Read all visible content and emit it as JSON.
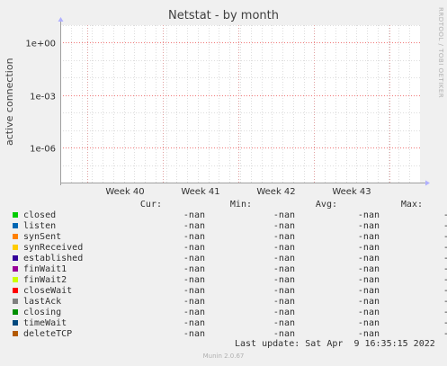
{
  "watermark": "RRDTOOL / TOBI OETIKER",
  "footer": "Munin 2.0.67",
  "last_update": "Last update: Sat Apr  9 16:35:15 2022",
  "columns": [
    "Cur:",
    "Min:",
    "Avg:",
    "Max:"
  ],
  "colors": {
    "background": "#f0f0f0",
    "plot_bg": "#ffffff",
    "grid_minor": "#dddddd",
    "grid_major": "#f07878",
    "vline_major": "#e0a0a0"
  },
  "legend": [
    {
      "name": "closed",
      "color": "#00cc00",
      "cur": "-nan",
      "min": "-nan",
      "avg": "-nan",
      "max": "-nan"
    },
    {
      "name": "listen",
      "color": "#0066b3",
      "cur": "-nan",
      "min": "-nan",
      "avg": "-nan",
      "max": "-nan"
    },
    {
      "name": "synSent",
      "color": "#ff8000",
      "cur": "-nan",
      "min": "-nan",
      "avg": "-nan",
      "max": "-nan"
    },
    {
      "name": "synReceived",
      "color": "#ffcc00",
      "cur": "-nan",
      "min": "-nan",
      "avg": "-nan",
      "max": "-nan"
    },
    {
      "name": "established",
      "color": "#330099",
      "cur": "-nan",
      "min": "-nan",
      "avg": "-nan",
      "max": "-nan"
    },
    {
      "name": "finWait1",
      "color": "#990099",
      "cur": "-nan",
      "min": "-nan",
      "avg": "-nan",
      "max": "-nan"
    },
    {
      "name": "finWait2",
      "color": "#ccff00",
      "cur": "-nan",
      "min": "-nan",
      "avg": "-nan",
      "max": "-nan"
    },
    {
      "name": "closeWait",
      "color": "#ff0000",
      "cur": "-nan",
      "min": "-nan",
      "avg": "-nan",
      "max": "-nan"
    },
    {
      "name": "lastAck",
      "color": "#808080",
      "cur": "-nan",
      "min": "-nan",
      "avg": "-nan",
      "max": "-nan"
    },
    {
      "name": "closing",
      "color": "#008f00",
      "cur": "-nan",
      "min": "-nan",
      "avg": "-nan",
      "max": "-nan"
    },
    {
      "name": "timeWait",
      "color": "#00487d",
      "cur": "-nan",
      "min": "-nan",
      "avg": "-nan",
      "max": "-nan"
    },
    {
      "name": "deleteTCP",
      "color": "#b35a00",
      "cur": "-nan",
      "min": "-nan",
      "avg": "-nan",
      "max": "-nan"
    }
  ],
  "chart_data": {
    "type": "line",
    "title": "Netstat - by month",
    "xlabel": "",
    "ylabel": "active connection",
    "y_scale": "log",
    "ylim": [
      1e-08,
      10
    ],
    "y_ticks": [
      {
        "label": "1e+00",
        "value": 1
      },
      {
        "label": "1e-03",
        "value": 0.001
      },
      {
        "label": "1e-06",
        "value": 1e-06
      }
    ],
    "x_ticks": [
      "Week 40",
      "Week 41",
      "Week 42",
      "Week 43"
    ],
    "grid": true,
    "series": [
      {
        "name": "closed",
        "values": []
      },
      {
        "name": "listen",
        "values": []
      },
      {
        "name": "synSent",
        "values": []
      },
      {
        "name": "synReceived",
        "values": []
      },
      {
        "name": "established",
        "values": []
      },
      {
        "name": "finWait1",
        "values": []
      },
      {
        "name": "finWait2",
        "values": []
      },
      {
        "name": "closeWait",
        "values": []
      },
      {
        "name": "lastAck",
        "values": []
      },
      {
        "name": "closing",
        "values": []
      },
      {
        "name": "timeWait",
        "values": []
      },
      {
        "name": "deleteTCP",
        "values": []
      }
    ]
  }
}
